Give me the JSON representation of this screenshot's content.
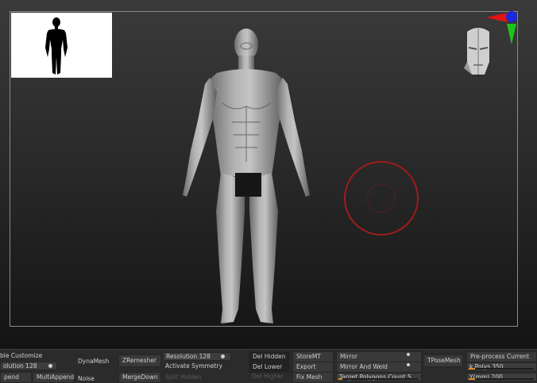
{
  "toolbar": {
    "enable_customize": "ble Customize",
    "resolution_left": "olution 128",
    "append": "pend",
    "multi_append": "MultiAppend",
    "dynamesh": "DynaMesh",
    "noise": "Noise",
    "zremesher": "ZRemesher",
    "merge_down": "MergeDown",
    "resolution_mid": "Resolution 128",
    "activate_symmetry": "Activate Symmetry",
    "split_hidden": "Split Hidden",
    "del_hidden": "Del Hidden",
    "del_lower": "Del Lower",
    "del_higher": "Del Higher",
    "store_mt": "StoreMT",
    "export": "Export",
    "fix_mesh": "Fix Mesh",
    "mirror": "Mirror",
    "mirror_and_weld": "Mirror And Weld",
    "target_polygons": "Target Polygons Count 5",
    "tpose_mesh": "TPoseMesh",
    "preprocess": "Pre-process Current",
    "k_polys": "k Polys 350",
    "y_mm": "Y(mm) 200"
  },
  "sliders": {
    "resolution_left_fraction": 0.1,
    "resolution_mid_fraction": 0.1,
    "target_polygons_fraction": 0.05,
    "k_polys_fraction": 0.1,
    "y_mm_fraction": 0.1
  },
  "colors": {
    "accent": "#e08a1a",
    "brush_ring": "#a01c1c",
    "axis_x": "#e01414",
    "axis_y": "#1cc41c",
    "axis_z": "#1a2ad8"
  },
  "icons": {
    "thumbnail": "human-silhouette-icon",
    "head_gizmo": "head-orientation-icon",
    "axis_gizmo": "xyz-axis-icon"
  }
}
